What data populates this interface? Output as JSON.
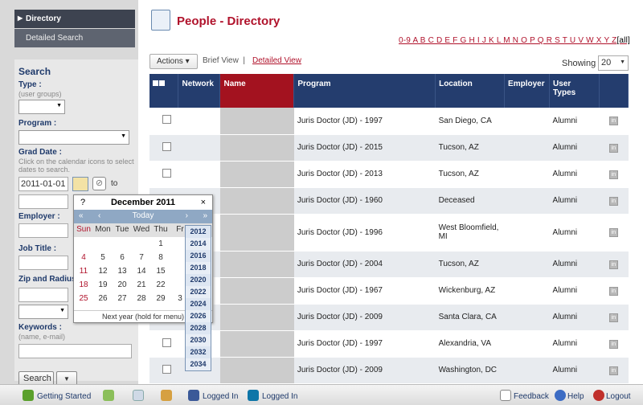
{
  "sidebar": {
    "directory": "Directory",
    "detailed_search": "Detailed Search"
  },
  "search": {
    "heading": "Search",
    "type_label": "Type :",
    "type_sub": "(user groups)",
    "program_label": "Program :",
    "grad_label": "Grad Date :",
    "grad_sub": "Click on the calendar icons to select dates to search.",
    "grad_from": "2011-01-01",
    "to": "to",
    "employer_label": "Employer :",
    "jobtitle_label": "Job Title :",
    "zip_label": "Zip and Radius",
    "keywords_label": "Keywords :",
    "keywords_sub": "(name, e-mail)",
    "search_button": "Search"
  },
  "page": {
    "title": "People - Directory",
    "alpha": "0-9 A B C D E F G H I J K L M N O P Q R S T U V W X Y Z",
    "all": "[all]"
  },
  "toolbar": {
    "actions": "Actions",
    "brief": "Brief View",
    "sep": "|",
    "detailed": "Detailed View",
    "showing": "Showing",
    "showing_value": "20"
  },
  "columns": [
    "Network",
    "Name",
    "Program",
    "Location",
    "Employer",
    "User Types"
  ],
  "rows": [
    {
      "program": "Juris Doctor (JD) - 1997",
      "location": "San Diego, CA",
      "type": "Alumni"
    },
    {
      "program": "Juris Doctor (JD) - 2015",
      "location": "Tucson, AZ",
      "type": "Alumni"
    },
    {
      "program": "Juris Doctor (JD) - 2013",
      "location": "Tucson, AZ",
      "type": "Alumni"
    },
    {
      "program": "Juris Doctor (JD) - 1960",
      "location": "Deceased",
      "type": "Alumni"
    },
    {
      "program": "Juris Doctor (JD) - 1996",
      "location": "West Bloomfield, MI",
      "type": "Alumni"
    },
    {
      "program": "Juris Doctor (JD) - 2004",
      "location": "Tucson, AZ",
      "type": "Alumni"
    },
    {
      "program": "Juris Doctor (JD) - 1967",
      "location": "Wickenburg, AZ",
      "type": "Alumni"
    },
    {
      "program": "Juris Doctor (JD) - 2009",
      "location": "Santa Clara, CA",
      "type": "Alumni"
    },
    {
      "program": "Juris Doctor (JD) - 1997",
      "location": "Alexandria, VA",
      "type": "Alumni"
    },
    {
      "program": "Juris Doctor (JD) - 2009",
      "location": "Washington, DC",
      "type": "Alumni"
    }
  ],
  "calendar": {
    "help": "?",
    "title": "December 2011",
    "close": "×",
    "today": "Today",
    "weekdays": [
      "Sun",
      "Mon",
      "Tue",
      "Wed",
      "Thu",
      "Fr"
    ],
    "weeks": [
      [
        "",
        "",
        "",
        "",
        "1",
        ""
      ],
      [
        "4",
        "5",
        "6",
        "7",
        "8",
        ""
      ],
      [
        "11",
        "12",
        "13",
        "14",
        "15",
        ""
      ],
      [
        "18",
        "19",
        "20",
        "21",
        "22",
        ""
      ],
      [
        "25",
        "26",
        "27",
        "28",
        "29",
        "3"
      ]
    ],
    "footer": "Next year (hold for menu)",
    "years": [
      "2012",
      "2014",
      "2016",
      "2018",
      "2020",
      "2022",
      "2024",
      "2026",
      "2028",
      "2030",
      "2032",
      "2034"
    ]
  },
  "footer": {
    "getting_started": "Getting Started",
    "logged_in_1": "Logged In",
    "logged_in_2": "Logged In",
    "feedback": "Feedback",
    "help": "Help",
    "logout": "Logout"
  }
}
